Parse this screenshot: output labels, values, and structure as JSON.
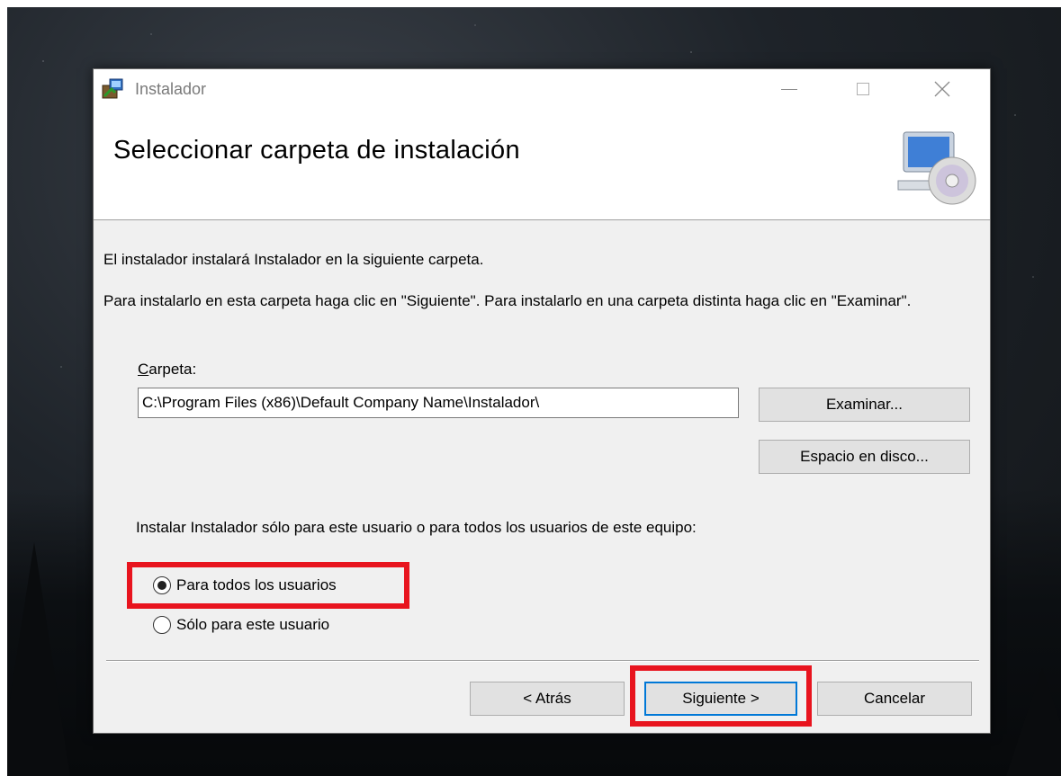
{
  "window": {
    "title": "Instalador",
    "banner_title": "Seleccionar carpeta de instalación"
  },
  "body": {
    "intro_line1": "El instalador instalará Instalador en la siguiente carpeta.",
    "intro_line2": "Para instalarlo en esta carpeta haga clic en \"Siguiente\". Para instalarlo en una carpeta distinta haga clic en \"Examinar\".",
    "folder_label_accel": "C",
    "folder_label_rest": "arpeta:",
    "folder_path": "C:\\Program Files (x86)\\Default Company Name\\Instalador\\",
    "browse_button": "Examinar...",
    "disk_space_button": "Espacio en disco...",
    "scope_question": "Instalar Instalador sólo para este usuario o para todos los usuarios de este equipo:",
    "radio_options": [
      {
        "label": "Para todos los usuarios",
        "selected": true
      },
      {
        "label": "Sólo para este usuario",
        "selected": false
      }
    ]
  },
  "footer": {
    "back_button": "< Atrás",
    "next_button": "Siguiente >",
    "cancel_button": "Cancelar"
  },
  "icons": {
    "app": "installer-package-icon",
    "banner": "computer-with-disc-icon",
    "minimize": "minimize-icon",
    "maximize": "maximize-icon",
    "close": "close-icon"
  },
  "colors": {
    "highlight": "#e8141e",
    "focus_border": "#0078d7",
    "dialog_bg": "#f0f0f0"
  }
}
